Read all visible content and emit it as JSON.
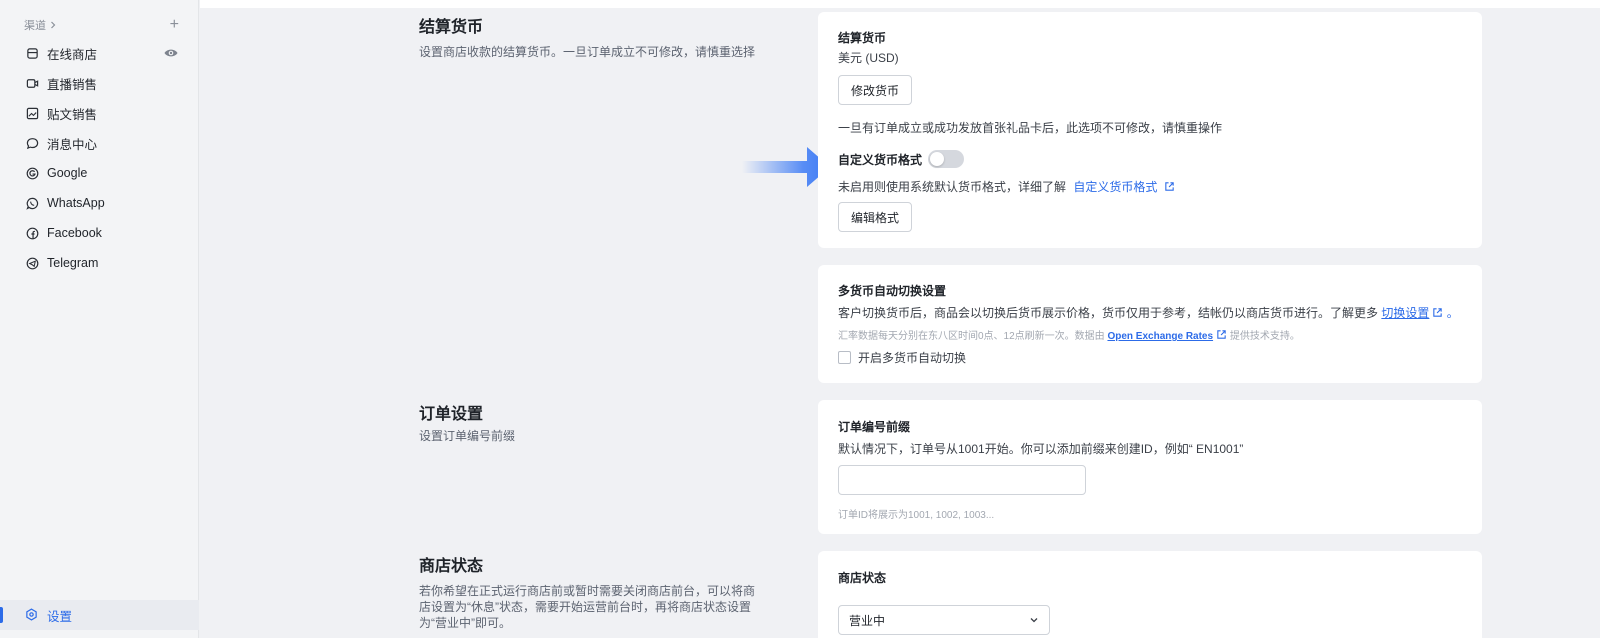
{
  "sidebar": {
    "section_title": "渠道",
    "items": [
      {
        "label": "在线商店",
        "icon": "store-icon"
      },
      {
        "label": "直播销售",
        "icon": "live-icon"
      },
      {
        "label": "贴文销售",
        "icon": "post-icon"
      },
      {
        "label": "消息中心",
        "icon": "message-icon"
      },
      {
        "label": "Google",
        "icon": "google-icon"
      },
      {
        "label": "WhatsApp",
        "icon": "whatsapp-icon"
      },
      {
        "label": "Facebook",
        "icon": "facebook-icon"
      },
      {
        "label": "Telegram",
        "icon": "telegram-icon"
      }
    ],
    "settings_label": "设置"
  },
  "currency_section": {
    "title": "结算货币",
    "description": "设置商店收款的结算货币。一旦订单成立不可修改，请慎重选择",
    "card": {
      "label": "结算货币",
      "value": "美元 (USD)",
      "change_button": "修改货币",
      "warning": "一旦有订单成立或成功发放首张礼品卡后，此选项不可修改，请慎重操作",
      "custom_format_label": "自定义货币格式",
      "custom_format_enabled": false,
      "custom_format_hint": "未启用则使用系统默认货币格式，详细了解",
      "custom_format_link": "自定义货币格式",
      "edit_button": "编辑格式"
    }
  },
  "multi_currency": {
    "title": "多货币自动切换设置",
    "description": "客户切换货币后，商品会以切换后货币展示价格，货币仅用于参考，结帐仍以商店货币进行。了解更多",
    "link": "切换设置",
    "period": "。",
    "note_prefix": "汇率数据每天分别在东八区时间0点、12点刷新一次。数据由",
    "note_link": "Open Exchange Rates",
    "note_suffix": "提供技术支持。",
    "checkbox_label": "开启多货币自动切换",
    "checkbox_checked": false
  },
  "order_section": {
    "title": "订单设置",
    "description": "设置订单编号前缀",
    "card": {
      "label": "订单编号前缀",
      "description": "默认情况下，订单号从1001开始。你可以添加前缀来创建ID，例如“ EN1001”",
      "input_value": "",
      "hint": "订单ID将展示为1001, 1002, 1003..."
    }
  },
  "store_status_section": {
    "title": "商店状态",
    "description": "若你希望在正式运行商店前或暂时需要关闭商店前台，可以将商店设置为“休息”状态，需要开始运营前台时，再将商店状态设置为“营业中”即可。",
    "card": {
      "label": "商店状态",
      "selected": "营业中"
    }
  },
  "colors": {
    "accent": "#2c6be8",
    "arrow": "#3d7bf5"
  }
}
